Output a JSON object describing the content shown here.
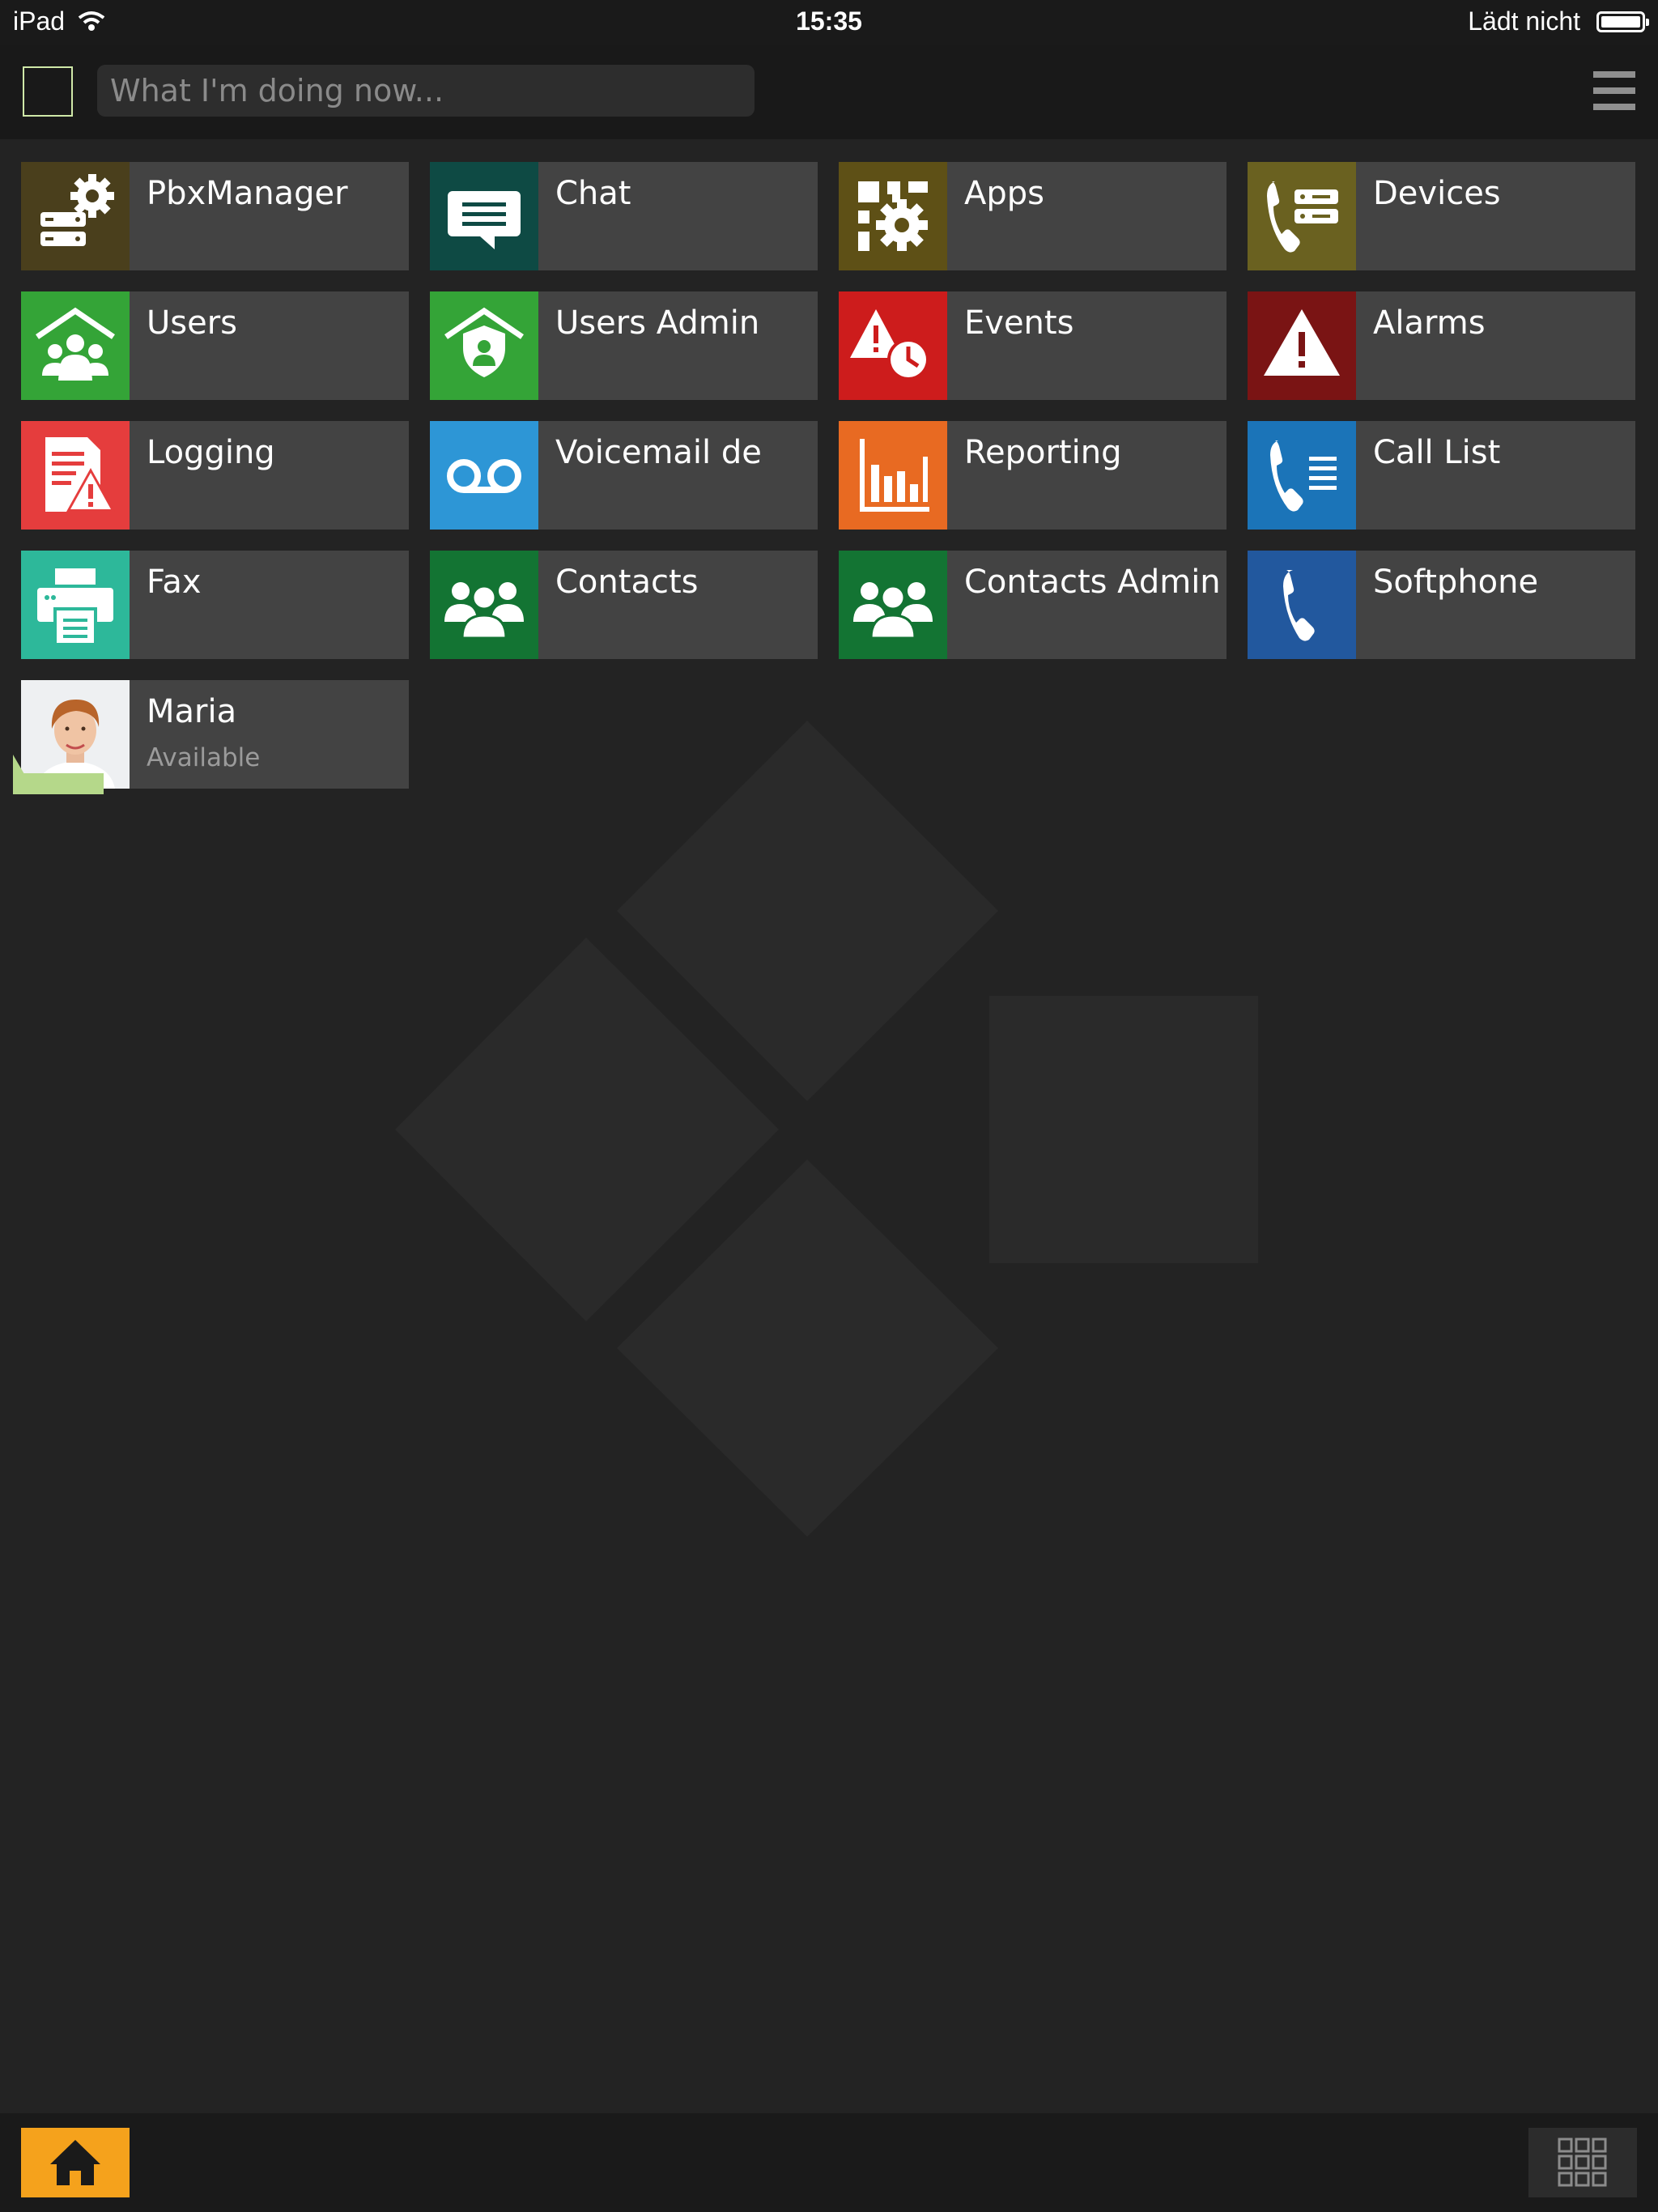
{
  "status_bar": {
    "device": "iPad",
    "time": "15:35",
    "charging_text": "Lädt nicht",
    "battery_level": 1.0
  },
  "top_bar": {
    "status_placeholder": "What I'm doing now...",
    "menu_icon": "hamburger-menu-icon"
  },
  "tiles": [
    {
      "label": "PbxManager",
      "icon": "pbx-manager-icon",
      "color": "#4a3f1c"
    },
    {
      "label": "Chat",
      "icon": "chat-bubble-icon",
      "color": "#0e4a44"
    },
    {
      "label": "Apps",
      "icon": "apps-gear-icon",
      "color": "#5e5016"
    },
    {
      "label": "Devices",
      "icon": "phone-devices-icon",
      "color": "#6a6120"
    },
    {
      "label": "Users",
      "icon": "users-house-icon",
      "color": "#34a437"
    },
    {
      "label": "Users Admin",
      "icon": "users-admin-shield-icon",
      "color": "#34a437"
    },
    {
      "label": "Events",
      "icon": "events-warning-clock-icon",
      "color": "#cd1c1c"
    },
    {
      "label": "Alarms",
      "icon": "alarm-warning-icon",
      "color": "#7a1414"
    },
    {
      "label": "Logging",
      "icon": "logging-document-icon",
      "color": "#e53d3d"
    },
    {
      "label": "Voicemail de",
      "icon": "voicemail-icon",
      "color": "#2d96d6"
    },
    {
      "label": "Reporting",
      "icon": "bar-chart-icon",
      "color": "#e86a22"
    },
    {
      "label": "Call List",
      "icon": "call-list-icon",
      "color": "#1b74b8"
    },
    {
      "label": "Fax",
      "icon": "fax-printer-icon",
      "color": "#2db89a"
    },
    {
      "label": "Contacts",
      "icon": "contacts-group-icon",
      "color": "#137433"
    },
    {
      "label": "Contacts Admin",
      "icon": "contacts-admin-group-icon",
      "color": "#137433"
    },
    {
      "label": "Softphone",
      "icon": "phone-handset-icon",
      "color": "#22589e"
    }
  ],
  "user_tile": {
    "name": "Maria",
    "status": "Available",
    "avatar": "user-avatar-photo",
    "presence_color": "#b5d88a"
  },
  "bottom_bar": {
    "home_icon": "home-icon",
    "apps_icon": "app-grid-icon",
    "home_color": "#f5a21c"
  }
}
